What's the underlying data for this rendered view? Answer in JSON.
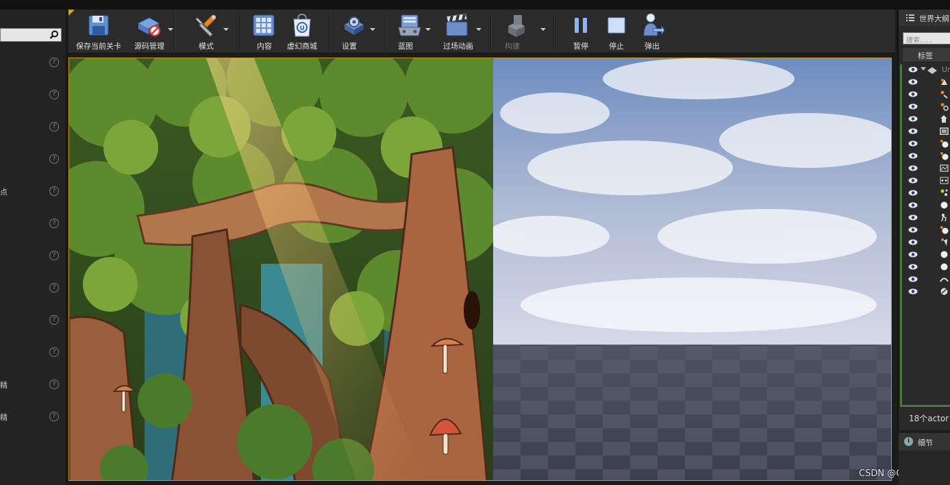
{
  "left_panel": {
    "search": {
      "placeholder": ""
    },
    "rows": [
      {
        "label": ""
      },
      {
        "label": ""
      },
      {
        "label": ""
      },
      {
        "label": ""
      },
      {
        "label": "点"
      },
      {
        "label": ""
      },
      {
        "label": ""
      },
      {
        "label": ""
      },
      {
        "label": ""
      },
      {
        "label": ""
      },
      {
        "label": "精"
      },
      {
        "label": "精"
      }
    ]
  },
  "toolbar": {
    "save_level": "保存当前关卡",
    "source_control": "源码管理",
    "modes": "模式",
    "content": "内容",
    "marketplace": "虚幻商城",
    "settings": "设置",
    "blueprints": "蓝图",
    "cinematics": "过场动画",
    "build": "构建",
    "pause": "暂停",
    "stop": "停止",
    "eject": "弹出"
  },
  "outliner": {
    "title": "世界大纲",
    "search_placeholder": "搜索......",
    "column_label": "标签",
    "root_label": "Un",
    "actor_count": "18个actor"
  },
  "details": {
    "title": "细节"
  },
  "watermark": "CSDN @Chocccllin",
  "colors": {
    "accent": "#c8961e",
    "panel": "#2b2b2b",
    "outliner_frame": "#4a7a3a"
  }
}
